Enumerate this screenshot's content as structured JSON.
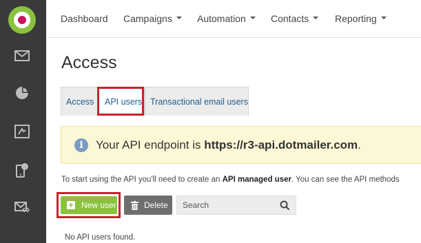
{
  "sidebar": {
    "logo": "dotmailer-logo",
    "items": [
      {
        "icon": "envelope-icon"
      },
      {
        "icon": "pie-chart-icon"
      },
      {
        "icon": "automation-icon"
      },
      {
        "icon": "mobile-icon"
      },
      {
        "icon": "email-code-icon"
      }
    ]
  },
  "nav": {
    "items": [
      {
        "label": "Dashboard",
        "dropdown": false
      },
      {
        "label": "Campaigns",
        "dropdown": true
      },
      {
        "label": "Automation",
        "dropdown": true
      },
      {
        "label": "Contacts",
        "dropdown": true
      },
      {
        "label": "Reporting",
        "dropdown": true
      }
    ]
  },
  "page": {
    "title": "Access"
  },
  "tabs": [
    {
      "label": "Access",
      "active": false
    },
    {
      "label": "API users",
      "active": true
    },
    {
      "label": "Transactional email users",
      "active": false
    }
  ],
  "banner": {
    "prefix": "Your API endpoint is ",
    "endpoint": "https://r3-api.dotmailer.com",
    "suffix": "."
  },
  "intro": {
    "prefix": "To start using the API you'll need to create an ",
    "emphasis": "API managed user",
    "suffix": ". You can see the API methods"
  },
  "toolbar": {
    "new_user_label": "New user",
    "delete_label": "Delete",
    "search_placeholder": "Search"
  },
  "empty_message": "No API users found.",
  "colors": {
    "sidebar": "#3a3a3a",
    "accent_green": "#8ac23f",
    "highlight_red": "#c9222b",
    "banner_bg": "#fcf8d6",
    "link_blue": "#1f5d8c"
  }
}
